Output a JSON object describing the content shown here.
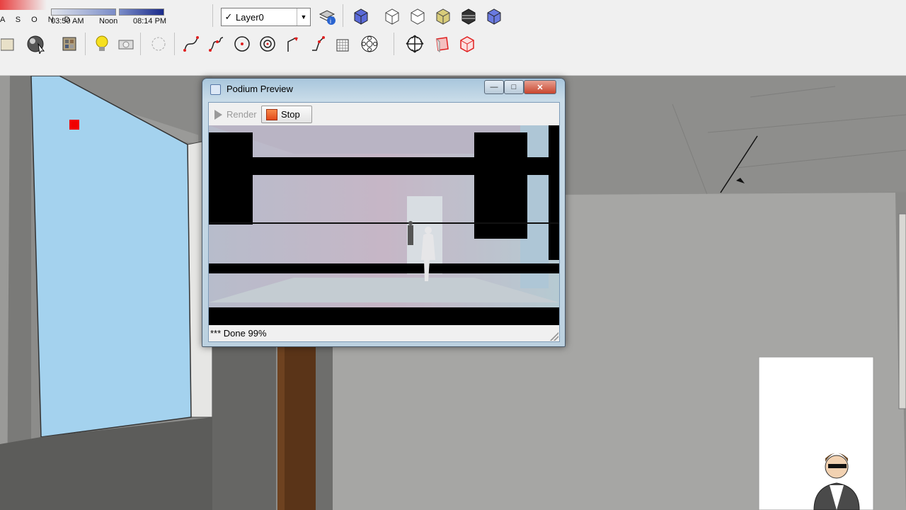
{
  "toolbar": {
    "shadow_months": "A S O N D",
    "time_start": "03:50 AM",
    "time_mid": "Noon",
    "time_end": "08:14 PM",
    "layer_check": "✓",
    "layer_name": "Layer0",
    "icons_row1": [
      "layer-manager-icon",
      "iso-view-icon",
      "top-view-icon",
      "front-view-icon",
      "right-view-icon",
      "back-view-icon",
      "left-view-icon",
      "bottom-view-icon"
    ],
    "icons_row2": [
      "materials-icon",
      "podium-sphere-icon",
      "podium-materials-icon",
      "light-bulb-icon",
      "omni-light-icon",
      "spot-light-icon",
      "arc-icon",
      "freehand-icon",
      "circle-icon",
      "offset-icon",
      "follow-me-icon",
      "pushpull-icon",
      "grid-icon",
      "component-icon",
      "orbit-icon",
      "section-plane-icon",
      "section-display-icon"
    ]
  },
  "podium": {
    "title": "Podium Preview",
    "render_label": "Render",
    "stop_label": "Stop",
    "status": "*** Done 99%"
  },
  "colors": {
    "wall_blue": "#a4d2ee",
    "render_red": "#e34a1a",
    "marker_red": "#f00000"
  }
}
